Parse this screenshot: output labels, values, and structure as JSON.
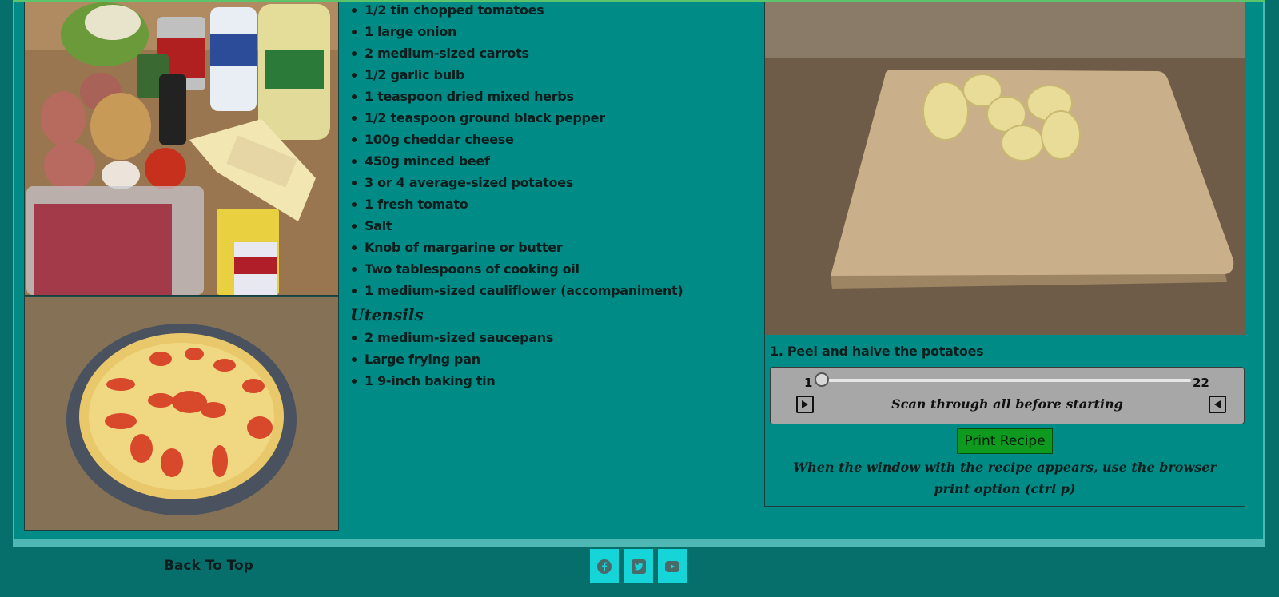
{
  "ingredients": [
    "1/2 tin chopped tomatoes",
    "1 large onion",
    "2 medium-sized carrots",
    "1/2 garlic bulb",
    "1 teaspoon dried mixed herbs",
    "1/2 teaspoon ground black pepper",
    "100g cheddar cheese",
    "450g minced beef",
    "3 or 4 average-sized potatoes",
    "1 fresh tomato",
    "Salt",
    "Knob of margarine or butter",
    "Two tablespoons of cooking oil",
    "1 medium-sized cauliflower (accompaniment)"
  ],
  "utensils_heading": "Utensils",
  "utensils": [
    "2 medium-sized saucepans",
    "Large frying pan",
    "1 9-inch baking tin"
  ],
  "step": {
    "caption": "1. Peel and halve the potatoes",
    "slider_min": "1",
    "slider_max": "22",
    "slider_value": 1,
    "scan_note": "Scan through all before starting"
  },
  "print": {
    "button_label": "Print Recipe",
    "note": "When the window with the recipe appears, use the browser print option (ctrl p)"
  },
  "footer": {
    "back_to_top": "Back To Top",
    "social_icons": [
      "facebook-icon",
      "twitter-icon",
      "youtube-icon"
    ]
  },
  "colors": {
    "page_bg": "#008b87",
    "footer_bg": "#066e6b",
    "print_button": "#0e9a1e",
    "social_button": "#16d5d9",
    "slider_panel": "#a7a7a7"
  }
}
